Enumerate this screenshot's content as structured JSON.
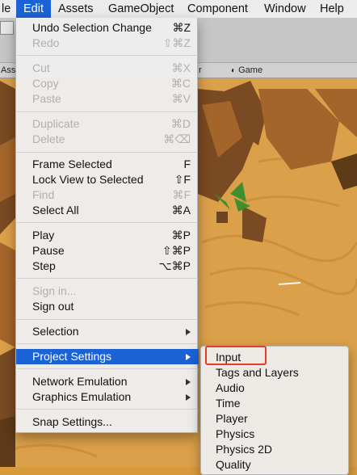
{
  "menubar": {
    "items": [
      {
        "label": "le",
        "active": false
      },
      {
        "label": "Edit",
        "active": true
      },
      {
        "label": "Assets",
        "active": false
      },
      {
        "label": "GameObject",
        "active": false
      },
      {
        "label": "Component",
        "active": false
      },
      {
        "label": "Window",
        "active": false
      },
      {
        "label": "Help",
        "active": false
      }
    ]
  },
  "editor": {
    "tab_partial": "Ass",
    "tab_partial_right": "r",
    "game_tab_label": "Game"
  },
  "edit_menu": {
    "items": [
      {
        "label": "Undo Selection Change",
        "shortcut": "⌘Z",
        "enabled": true
      },
      {
        "label": "Redo",
        "shortcut": "⇧⌘Z",
        "enabled": false
      },
      {
        "label": "Cut",
        "shortcut": "⌘X",
        "enabled": false
      },
      {
        "label": "Copy",
        "shortcut": "⌘C",
        "enabled": false
      },
      {
        "label": "Paste",
        "shortcut": "⌘V",
        "enabled": false
      },
      {
        "label": "Duplicate",
        "shortcut": "⌘D",
        "enabled": false
      },
      {
        "label": "Delete",
        "shortcut": "⌘⌫",
        "enabled": false
      },
      {
        "label": "Frame Selected",
        "shortcut": "F",
        "enabled": true
      },
      {
        "label": "Lock View to Selected",
        "shortcut": "⇧F",
        "enabled": true
      },
      {
        "label": "Find",
        "shortcut": "⌘F",
        "enabled": false
      },
      {
        "label": "Select All",
        "shortcut": "⌘A",
        "enabled": true
      },
      {
        "label": "Play",
        "shortcut": "⌘P",
        "enabled": true
      },
      {
        "label": "Pause",
        "shortcut": "⇧⌘P",
        "enabled": true
      },
      {
        "label": "Step",
        "shortcut": "⌥⌘P",
        "enabled": true
      },
      {
        "label": "Sign in...",
        "shortcut": "",
        "enabled": false
      },
      {
        "label": "Sign out",
        "shortcut": "",
        "enabled": true
      },
      {
        "label": "Selection",
        "shortcut": "",
        "enabled": true,
        "submenu": true
      },
      {
        "label": "Project Settings",
        "shortcut": "",
        "enabled": true,
        "submenu": true,
        "highlighted": true
      },
      {
        "label": "Network Emulation",
        "shortcut": "",
        "enabled": true,
        "submenu": true
      },
      {
        "label": "Graphics Emulation",
        "shortcut": "",
        "enabled": true,
        "submenu": true
      },
      {
        "label": "Snap Settings...",
        "shortcut": "",
        "enabled": true
      }
    ]
  },
  "project_settings_submenu": {
    "items": [
      "Input",
      "Tags and Layers",
      "Audio",
      "Time",
      "Player",
      "Physics",
      "Physics 2D",
      "Quality"
    ]
  },
  "colors": {
    "highlight": "#1b62d6",
    "annotation": "#e53b2a",
    "sand": "#d99a3c"
  }
}
